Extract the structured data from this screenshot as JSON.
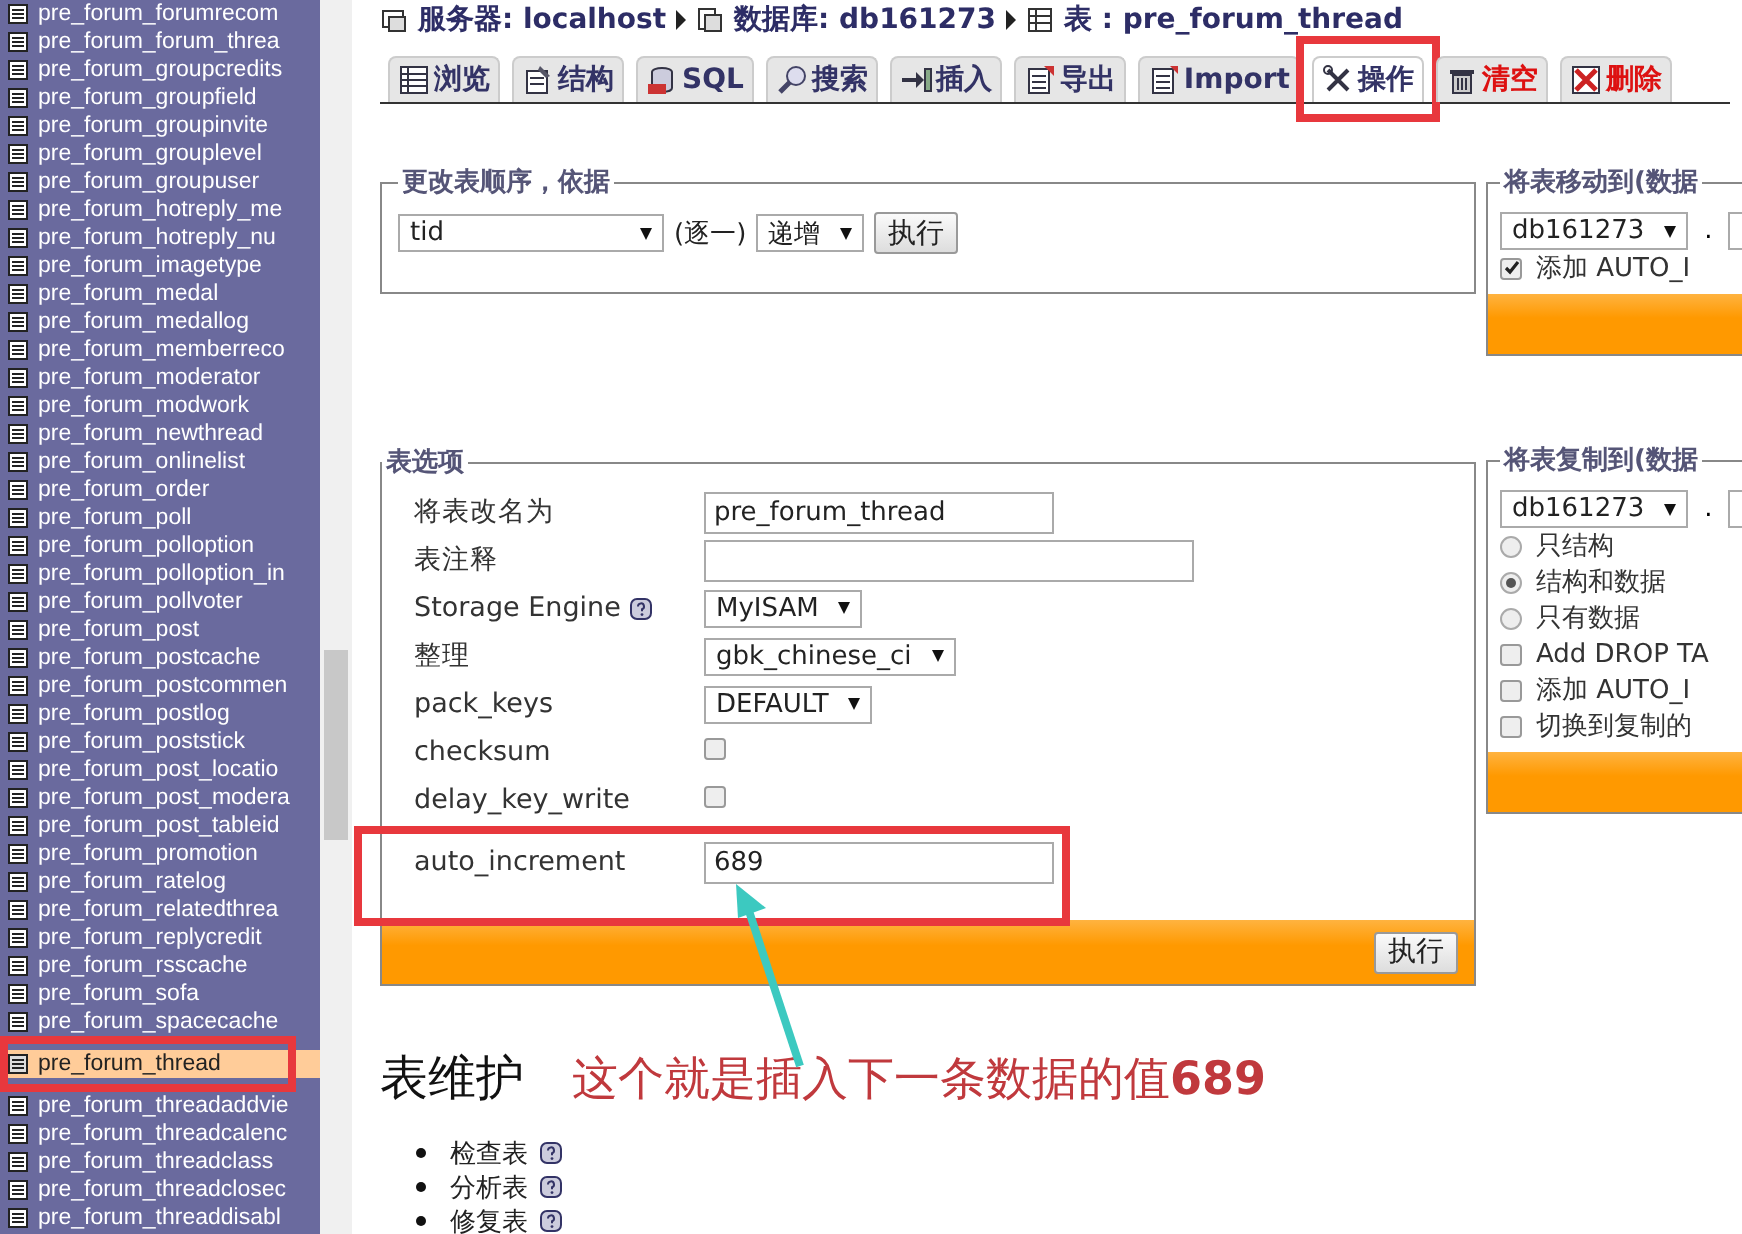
{
  "sidebar": {
    "items": [
      {
        "label": "pre_forum_forumrecom",
        "selected": false
      },
      {
        "label": "pre_forum_forum_threa",
        "selected": false
      },
      {
        "label": "pre_forum_groupcredits",
        "selected": false
      },
      {
        "label": "pre_forum_groupfield",
        "selected": false
      },
      {
        "label": "pre_forum_groupinvite",
        "selected": false
      },
      {
        "label": "pre_forum_grouplevel",
        "selected": false
      },
      {
        "label": "pre_forum_groupuser",
        "selected": false
      },
      {
        "label": "pre_forum_hotreply_me",
        "selected": false
      },
      {
        "label": "pre_forum_hotreply_nu",
        "selected": false
      },
      {
        "label": "pre_forum_imagetype",
        "selected": false
      },
      {
        "label": "pre_forum_medal",
        "selected": false
      },
      {
        "label": "pre_forum_medallog",
        "selected": false
      },
      {
        "label": "pre_forum_memberreco",
        "selected": false
      },
      {
        "label": "pre_forum_moderator",
        "selected": false
      },
      {
        "label": "pre_forum_modwork",
        "selected": false
      },
      {
        "label": "pre_forum_newthread",
        "selected": false
      },
      {
        "label": "pre_forum_onlinelist",
        "selected": false
      },
      {
        "label": "pre_forum_order",
        "selected": false
      },
      {
        "label": "pre_forum_poll",
        "selected": false
      },
      {
        "label": "pre_forum_polloption",
        "selected": false
      },
      {
        "label": "pre_forum_polloption_in",
        "selected": false
      },
      {
        "label": "pre_forum_pollvoter",
        "selected": false
      },
      {
        "label": "pre_forum_post",
        "selected": false
      },
      {
        "label": "pre_forum_postcache",
        "selected": false
      },
      {
        "label": "pre_forum_postcommen",
        "selected": false
      },
      {
        "label": "pre_forum_postlog",
        "selected": false
      },
      {
        "label": "pre_forum_poststick",
        "selected": false
      },
      {
        "label": "pre_forum_post_locatio",
        "selected": false
      },
      {
        "label": "pre_forum_post_modera",
        "selected": false
      },
      {
        "label": "pre_forum_post_tableid",
        "selected": false
      },
      {
        "label": "pre_forum_promotion",
        "selected": false
      },
      {
        "label": "pre_forum_ratelog",
        "selected": false
      },
      {
        "label": "pre_forum_relatedthrea",
        "selected": false
      },
      {
        "label": "pre_forum_replycredit",
        "selected": false
      },
      {
        "label": "pre_forum_rsscache",
        "selected": false
      },
      {
        "label": "pre_forum_sofa",
        "selected": false
      },
      {
        "label": "pre_forum_spacecache",
        "selected": false
      },
      {
        "label": "pre_forum_thread",
        "selected": true
      },
      {
        "label": "pre_forum_threadaddvie",
        "selected": false
      },
      {
        "label": "pre_forum_threadcalenc",
        "selected": false
      },
      {
        "label": "pre_forum_threadclass",
        "selected": false
      },
      {
        "label": "pre_forum_threadclosec",
        "selected": false
      },
      {
        "label": "pre_forum_threaddisabl",
        "selected": false
      }
    ]
  },
  "breadcrumb": [
    {
      "kind": "server",
      "label": "服务器: localhost"
    },
    {
      "kind": "database",
      "label": "数据库: db161273"
    },
    {
      "kind": "table",
      "label": "表 : pre_forum_thread"
    }
  ],
  "tabs": [
    {
      "kind": "browse",
      "label": "浏览",
      "selected": false
    },
    {
      "kind": "structure",
      "label": "结构",
      "selected": false
    },
    {
      "kind": "sql",
      "label": "SQL",
      "selected": false
    },
    {
      "kind": "search",
      "label": "搜索",
      "selected": false
    },
    {
      "kind": "insert",
      "label": "插入",
      "selected": false
    },
    {
      "kind": "export",
      "label": "导出",
      "selected": false
    },
    {
      "kind": "import",
      "label": "Import",
      "selected": false
    },
    {
      "kind": "operations",
      "label": "操作",
      "selected": true
    },
    {
      "kind": "empty",
      "label": "清空",
      "selected": false
    },
    {
      "kind": "drop",
      "label": "删除",
      "selected": false
    }
  ],
  "order_section": {
    "title": "更改表顺序，依据",
    "column": "tid",
    "between": "(逐一)",
    "direction": "递增",
    "button": "执行"
  },
  "options_section": {
    "title": "表选项",
    "rows": [
      {
        "kind": "text",
        "label": "将表改名为",
        "value": "pre_forum_thread",
        "highlighted": false
      },
      {
        "kind": "comment",
        "label": "表注释",
        "highlighted": false
      },
      {
        "kind": "select",
        "label": "Storage Engine",
        "help": true,
        "value": "MyISAM",
        "highlighted": false
      },
      {
        "kind": "select",
        "label": "整理",
        "value": "gbk_chinese_ci",
        "highlighted": false
      },
      {
        "kind": "select",
        "label": "pack_keys",
        "value": "DEFAULT",
        "highlighted": false
      },
      {
        "kind": "checkbox",
        "label": "checksum",
        "checked": false,
        "highlighted": false
      },
      {
        "kind": "checkbox",
        "label": "delay_key_write",
        "checked": false,
        "highlighted": false
      },
      {
        "kind": "text",
        "label": "auto_increment",
        "value": "689",
        "highlighted": true
      }
    ],
    "button": "执行"
  },
  "annotation": {
    "caption": "这个就是插入下一条数据的值**689**"
  },
  "maintenance": {
    "title": "表维护",
    "items": [
      {
        "label": "检查表"
      },
      {
        "label": "分析表"
      },
      {
        "label": "修复表"
      }
    ]
  },
  "move_section": {
    "title": "将表移动到(数据",
    "database": "db161273",
    "separator": ".",
    "options": [
      {
        "kind": "checkbox",
        "label": "添加 AUTO_I",
        "checked": true
      }
    ]
  },
  "copy_section": {
    "title": "将表复制到(数据",
    "database": "db161273",
    "separator": ".",
    "options": [
      {
        "kind": "radio",
        "label": "只结构",
        "selected": false
      },
      {
        "kind": "radio",
        "label": "结构和数据",
        "selected": true
      },
      {
        "kind": "radio",
        "label": "只有数据",
        "selected": false
      },
      {
        "kind": "checkbox",
        "label": "Add DROP TA",
        "checked": false
      },
      {
        "kind": "checkbox",
        "label": "添加 AUTO_I",
        "checked": false
      },
      {
        "kind": "checkbox",
        "label": "切换到复制的",
        "checked": false
      }
    ]
  }
}
